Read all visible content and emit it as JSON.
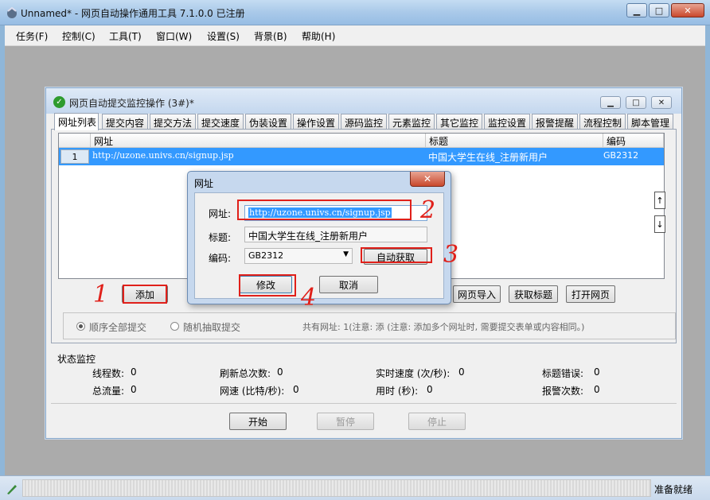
{
  "app": {
    "title": "Unnamed* - 网页自动操作通用工具 7.1.0.0  已注册",
    "caption_minimize": "▁",
    "caption_maximize": "□",
    "caption_close": "✕"
  },
  "menu": [
    "任务(F)",
    "控制(C)",
    "工具(T)",
    "窗口(W)",
    "设置(S)",
    "背景(B)",
    "帮助(H)"
  ],
  "inner_window": {
    "title": "网页自动提交监控操作  (3#)*",
    "tabs": [
      "网址列表",
      "提交内容",
      "提交方法",
      "提交速度",
      "伪装设置",
      "操作设置",
      "源码监控",
      "元素监控",
      "其它监控",
      "监控设置",
      "报警提醒",
      "流程控制",
      "脚本管理"
    ],
    "active_tab": "网址列表"
  },
  "url_table": {
    "columns": [
      "网址",
      "标题",
      "编码"
    ],
    "rows": [
      {
        "num": "1",
        "url": "http://uzone.univs.cn/signup.jsp",
        "title": "中国大学生在线_注册新用户",
        "encoding": "GB2312"
      }
    ]
  },
  "list_buttons": {
    "add": "添加",
    "import": "网页导入",
    "get_title": "获取标题",
    "open": "打开网页"
  },
  "submit_mode": {
    "sequential": "顺序全部提交",
    "random": "随机抽取提交",
    "info": "共有网址: 1(注意: 添 (注意: 添加多个网址时, 需要提交表单或内容相同。)"
  },
  "status_monitor": {
    "heading": "状态监控",
    "threads_label": "线程数:",
    "threads_value": "0",
    "refresh_label": "刷新总次数:",
    "refresh_value": "0",
    "speed_label": "实时速度 (次/秒):",
    "speed_value": "0",
    "title_err_label": "标题错误:",
    "title_err_value": "0",
    "traffic_label": "总流量:",
    "traffic_value": "0",
    "netspeed_label": "网速 (比特/秒):",
    "netspeed_value": "0",
    "time_label": "用时 (秒):",
    "time_value": "0",
    "alarm_label": "报警次数:",
    "alarm_value": "0"
  },
  "controls": {
    "start": "开始",
    "pause": "暂停",
    "stop": "停止"
  },
  "dialog": {
    "title": "网址",
    "close": "✕",
    "url_label": "网址:",
    "url_value": "http://uzone.univs.cn/signup.jsp",
    "title_label": "标题:",
    "title_value": "中国大学生在线_注册新用户",
    "encoding_label": "编码:",
    "encoding_value": "GB2312",
    "auto_get": "自动获取",
    "modify": "修改",
    "cancel": "取消"
  },
  "annotations": [
    "1",
    "2",
    "3",
    "4"
  ],
  "statusbar": {
    "text": "准备就绪"
  },
  "colors": {
    "highlight": "#3399ff",
    "annotation": "#e0201a"
  }
}
